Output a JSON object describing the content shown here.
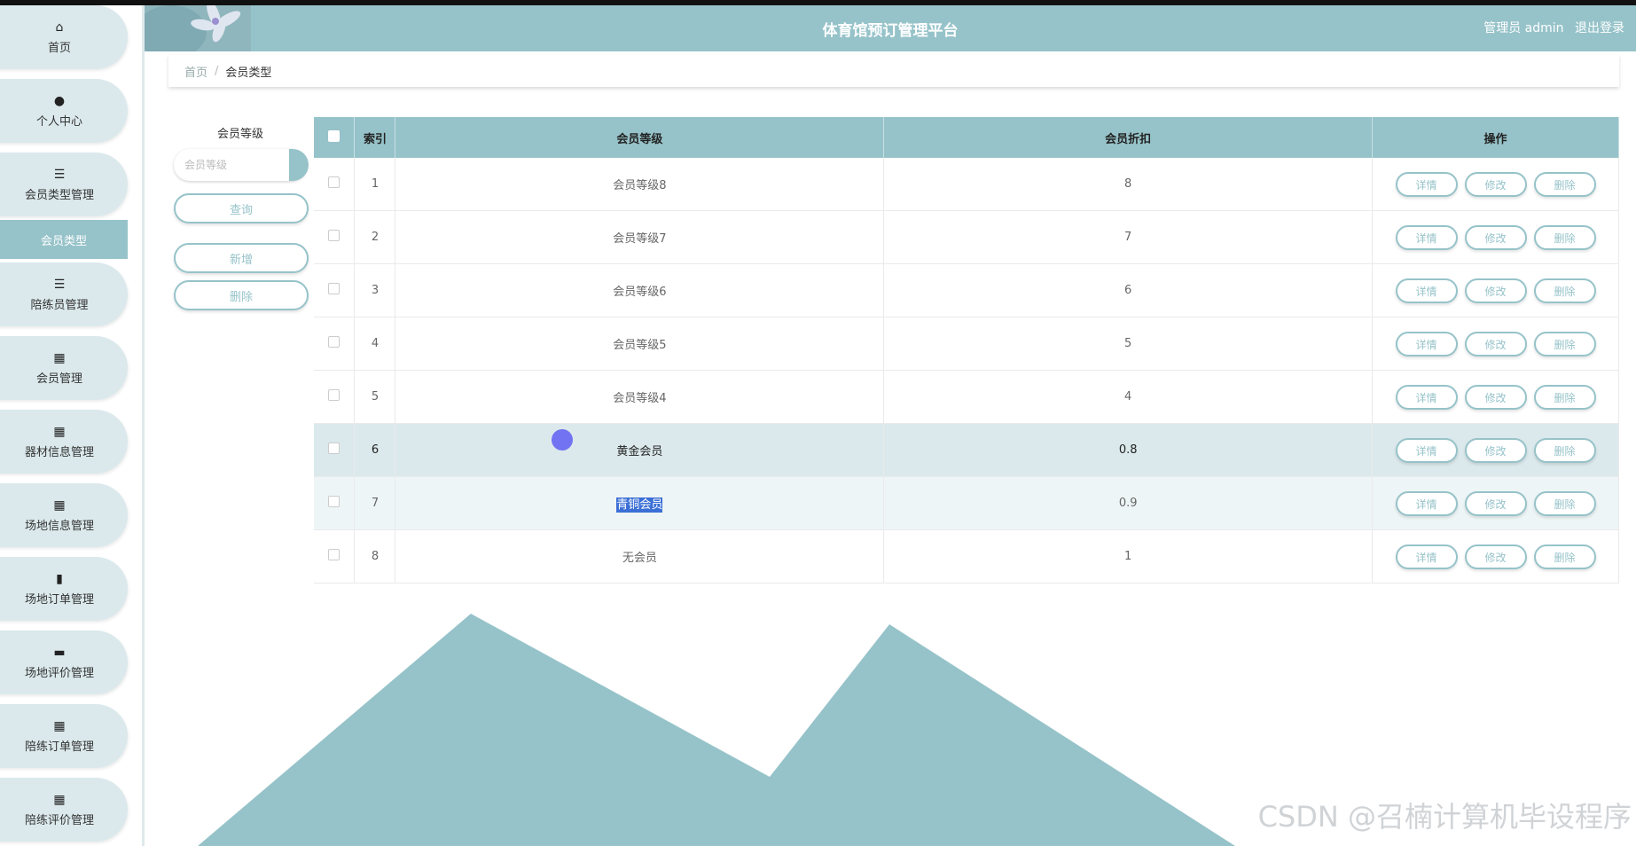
{
  "app": {
    "title": "体育馆预订管理平台",
    "user_label": "管理员 admin",
    "logout": "退出登录"
  },
  "sidebar": {
    "items": [
      {
        "label": "首页",
        "icon": "home-icon"
      },
      {
        "label": "个人中心",
        "icon": "user-icon"
      },
      {
        "label": "会员类型管理",
        "icon": "list-icon"
      },
      {
        "label": "陪练员管理",
        "icon": "list-icon"
      },
      {
        "label": "会员管理",
        "icon": "grid-icon"
      },
      {
        "label": "器材信息管理",
        "icon": "grid-icon"
      },
      {
        "label": "场地信息管理",
        "icon": "grid-icon"
      },
      {
        "label": "场地订单管理",
        "icon": "book-icon"
      },
      {
        "label": "场地评价管理",
        "icon": "monitor-icon"
      },
      {
        "label": "陪练订单管理",
        "icon": "grid-icon"
      },
      {
        "label": "陪练评价管理",
        "icon": "grid-icon"
      }
    ],
    "active_sub": "会员类型"
  },
  "breadcrumb": {
    "home": "首页",
    "separator": "/",
    "current": "会员类型"
  },
  "filter": {
    "label": "会员等级",
    "placeholder": "会员等级",
    "search_button": "查询",
    "add_button": "新增",
    "delete_button": "删除"
  },
  "table": {
    "headers": [
      "索引",
      "会员等级",
      "会员折扣",
      "操作"
    ],
    "rows": [
      {
        "index": "1",
        "level": "会员等级8",
        "discount": "8"
      },
      {
        "index": "2",
        "level": "会员等级7",
        "discount": "7"
      },
      {
        "index": "3",
        "level": "会员等级6",
        "discount": "6"
      },
      {
        "index": "4",
        "level": "会员等级5",
        "discount": "5"
      },
      {
        "index": "5",
        "level": "会员等级4",
        "discount": "4"
      },
      {
        "index": "6",
        "level": "黄金会员",
        "discount": "0.8"
      },
      {
        "index": "7",
        "level": "青铜会员",
        "discount": "0.9"
      },
      {
        "index": "8",
        "level": "无会员",
        "discount": "1"
      }
    ],
    "actions": {
      "detail": "详情",
      "edit": "修改",
      "delete": "删除"
    }
  },
  "watermark": "CSDN @召楠计算机毕设程序",
  "colors": {
    "accent": "#96c3c9",
    "sidebar_bg": "#dbe9ec",
    "selection": "#3b6fd6"
  }
}
